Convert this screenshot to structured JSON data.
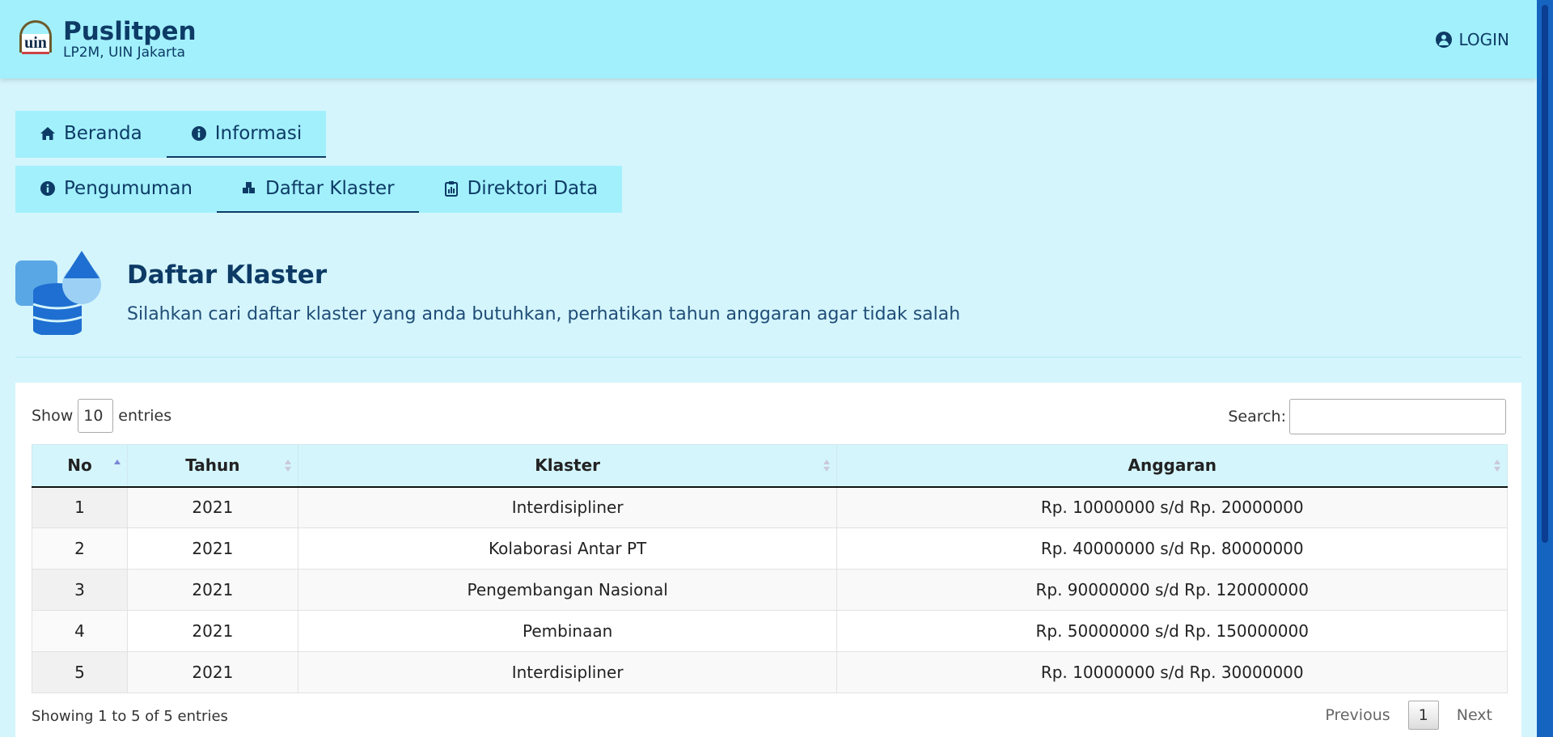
{
  "header": {
    "brand_name": "Puslitpen",
    "brand_sub": "LP2M, UIN Jakarta",
    "logo_text": "uin",
    "login_label": "LOGIN"
  },
  "nav": {
    "primary": [
      {
        "label": "Beranda",
        "icon": "home-icon",
        "active": false
      },
      {
        "label": "Informasi",
        "icon": "info-icon",
        "active": true
      }
    ],
    "secondary": [
      {
        "label": "Pengumuman",
        "icon": "info-icon",
        "active": false
      },
      {
        "label": "Daftar Klaster",
        "icon": "cubes-icon",
        "active": true
      },
      {
        "label": "Direktori Data",
        "icon": "clipboard-chart-icon",
        "active": false
      }
    ]
  },
  "page": {
    "title": "Daftar Klaster",
    "subtitle": "Silahkan cari daftar klaster yang anda butuhkan, perhatikan tahun anggaran agar tidak salah",
    "icon": "database-upload-icon"
  },
  "table_controls": {
    "show_label": "Show",
    "entries_value": "10",
    "entries_label": "entries",
    "search_label": "Search:",
    "search_value": ""
  },
  "table": {
    "columns": [
      "No",
      "Tahun",
      "Klaster",
      "Anggaran"
    ],
    "rows": [
      [
        "1",
        "2021",
        "Interdisipliner",
        "Rp. 10000000 s/d Rp. 20000000"
      ],
      [
        "2",
        "2021",
        "Kolaborasi Antar PT",
        "Rp. 40000000 s/d Rp. 80000000"
      ],
      [
        "3",
        "2021",
        "Pengembangan Nasional",
        "Rp. 90000000 s/d Rp. 120000000"
      ],
      [
        "4",
        "2021",
        "Pembinaan",
        "Rp. 50000000 s/d Rp. 150000000"
      ],
      [
        "5",
        "2021",
        "Interdisipliner",
        "Rp. 10000000 s/d Rp. 30000000"
      ]
    ]
  },
  "footer": {
    "info": "Showing 1 to 5 of 5 entries",
    "previous": "Previous",
    "page": "1",
    "next": "Next"
  },
  "colors": {
    "header_bg": "#a2f0fc",
    "page_bg": "#d4f5fc",
    "primary_text": "#0d3b66",
    "scrollbar": "#1565c0"
  }
}
